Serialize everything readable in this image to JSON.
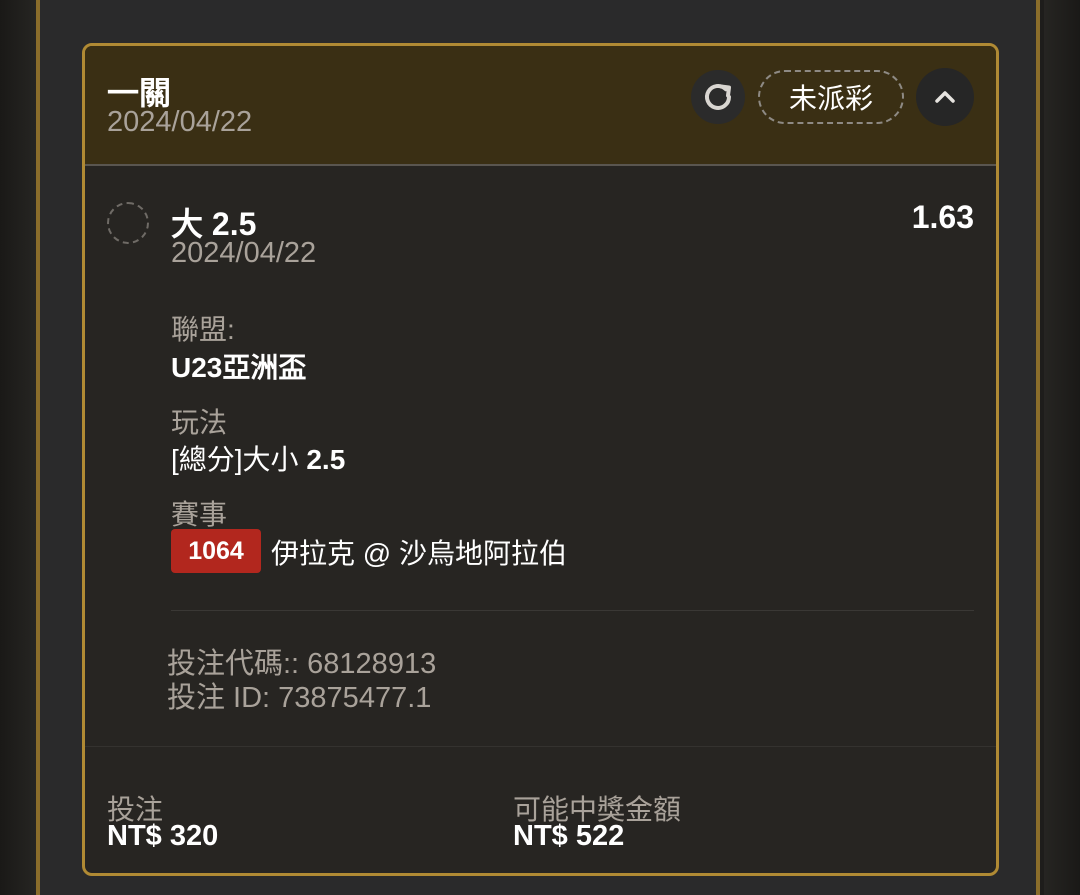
{
  "header": {
    "title": "一關",
    "date": "2024/04/22",
    "status": "未派彩",
    "refresh_icon": "refresh-icon",
    "collapse_icon": "chevron-up-icon"
  },
  "selection": {
    "name": "大 2.5",
    "date": "2024/04/22",
    "odds": "1.63"
  },
  "details": {
    "league_label": "聯盟:",
    "league_value": "U23亞洲盃",
    "market_label": "玩法",
    "market_value_prefix": "[總分]大小 ",
    "market_value_line": "2.5",
    "event_label": "賽事",
    "event_id": "1064",
    "event_teams": "伊拉克 @ 沙烏地阿拉伯"
  },
  "codes": {
    "bet_code": "投注代碼:: 68128913",
    "bet_id": "投注 ID: 73875477.1"
  },
  "footer": {
    "stake_label": "投注",
    "stake_value": "NT$ 320",
    "payout_label": "可能中獎金額",
    "payout_value": "NT$ 522"
  },
  "colors": {
    "accent_gold": "#b08a34",
    "header_bg": "#3a2f14",
    "badge_red": "#b2271e"
  }
}
